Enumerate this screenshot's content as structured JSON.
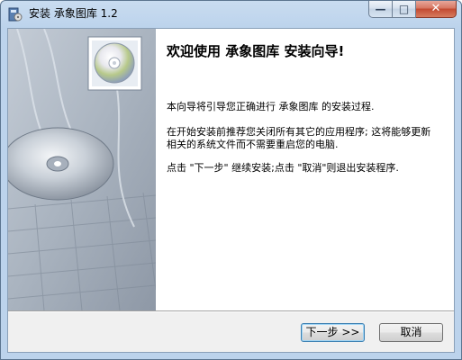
{
  "window": {
    "title": "安装 承象图库 1.2",
    "minimize_glyph": "—",
    "maximize_glyph": "□",
    "close_glyph": "✕"
  },
  "wizard": {
    "heading": "欢迎使用 承象图库 安装向导!",
    "paragraph1": "本向导将引导您正确进行 承象图库 的安装过程.",
    "paragraph2": "在开始安装前推荐您关闭所有其它的应用程序; 这将能够更新相关的系统文件而不需要重启您的电脑.",
    "paragraph3": "点击 \"下一步\" 继续安装;点击 \"取消\"则退出安装程序."
  },
  "buttons": {
    "next_label": "下一步 >>",
    "cancel_label": "取消"
  },
  "icons": {
    "app": "installer-app-icon",
    "side_image": "cd-disc-banner"
  },
  "colors": {
    "titlebar": "#c9dcf0",
    "close_button": "#c24a31",
    "dialog_bg": "#f0f0f0",
    "side_banner": "#b9c2cc"
  }
}
